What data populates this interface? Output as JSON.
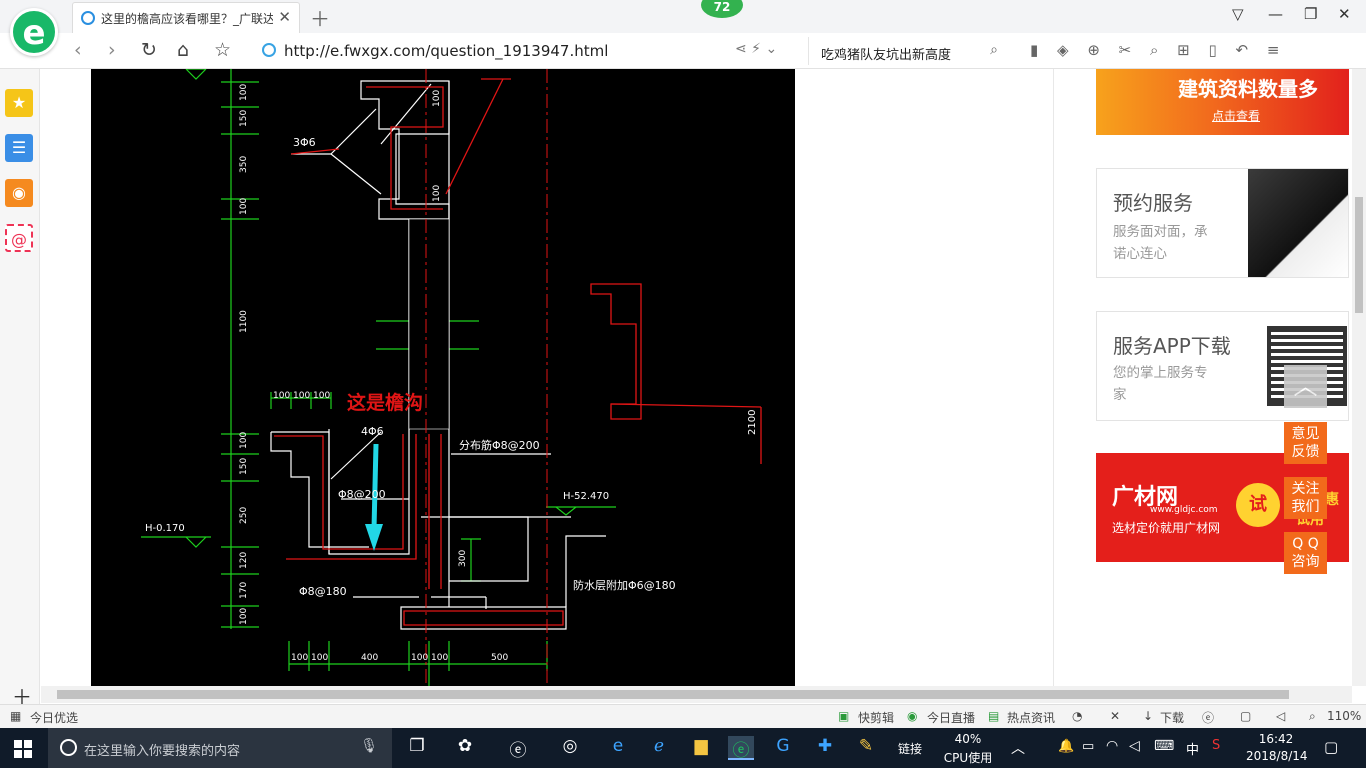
{
  "browser": {
    "tab_title": "这里的檐高应该看哪里？_广联达",
    "badge": "72",
    "url": "http://e.fwxgx.com/question_1913947.html",
    "search_text": "吃鸡猪队友坑出新高度",
    "logo_letter": "e"
  },
  "drawing": {
    "annotation_red": "这是檐沟",
    "rebar_3phi6": "3Φ6",
    "rebar_4phi6": "4Φ6",
    "dist_rebar": "分布筋Φ8@200",
    "phi8_200": "Φ8@200",
    "phi8_180": "Φ8@180",
    "elev_left": "H-0.170",
    "elev_right": "H-52.470",
    "waterproof": "防水层附加Φ6@180",
    "dims_vertical_top": [
      "100",
      "150",
      "350",
      "100",
      "1100"
    ],
    "dims_vertical_bottom": [
      "100",
      "150",
      "250",
      "120",
      "170",
      "100"
    ],
    "dims_top_row": [
      "100",
      "100",
      "100"
    ],
    "dims_bottom_row": [
      "100",
      "100",
      "400",
      "100",
      "100",
      "500"
    ],
    "dim_right": "2100",
    "dim_300": "300",
    "dim_100a": "100",
    "dim_100b": "100"
  },
  "ads": {
    "top_banner": {
      "title": "建筑资料数量多",
      "link": "点击查看"
    },
    "service": {
      "title": "预约服务",
      "desc": [
        "服务面对面，承",
        "诺心连心"
      ]
    },
    "app": {
      "title": "服务APP下载",
      "desc": [
        "您的掌上服务专",
        "家"
      ]
    },
    "glodon": {
      "brand": "广材网",
      "site": "www.gldjc.com",
      "slogan": "选材定价就用广材网",
      "try": "试",
      "side_text": "P 优惠试用"
    }
  },
  "floating": {
    "back_to_top": "︿",
    "feedback": [
      "意见",
      "反馈"
    ],
    "follow": [
      "关注",
      "我们"
    ],
    "qq": [
      "Q Q",
      "咨询"
    ]
  },
  "statusbar": {
    "today": "今日优选",
    "items": [
      "快剪辑",
      "今日直播",
      "热点资讯",
      "下载"
    ],
    "zoom": "110%"
  },
  "taskbar": {
    "search_placeholder": "在这里输入你要搜索的内容",
    "link": "链接",
    "cpu_percent": "40%",
    "cpu_label": "CPU使用",
    "ime": "中",
    "time": "16:42",
    "date": "2018/8/14"
  }
}
